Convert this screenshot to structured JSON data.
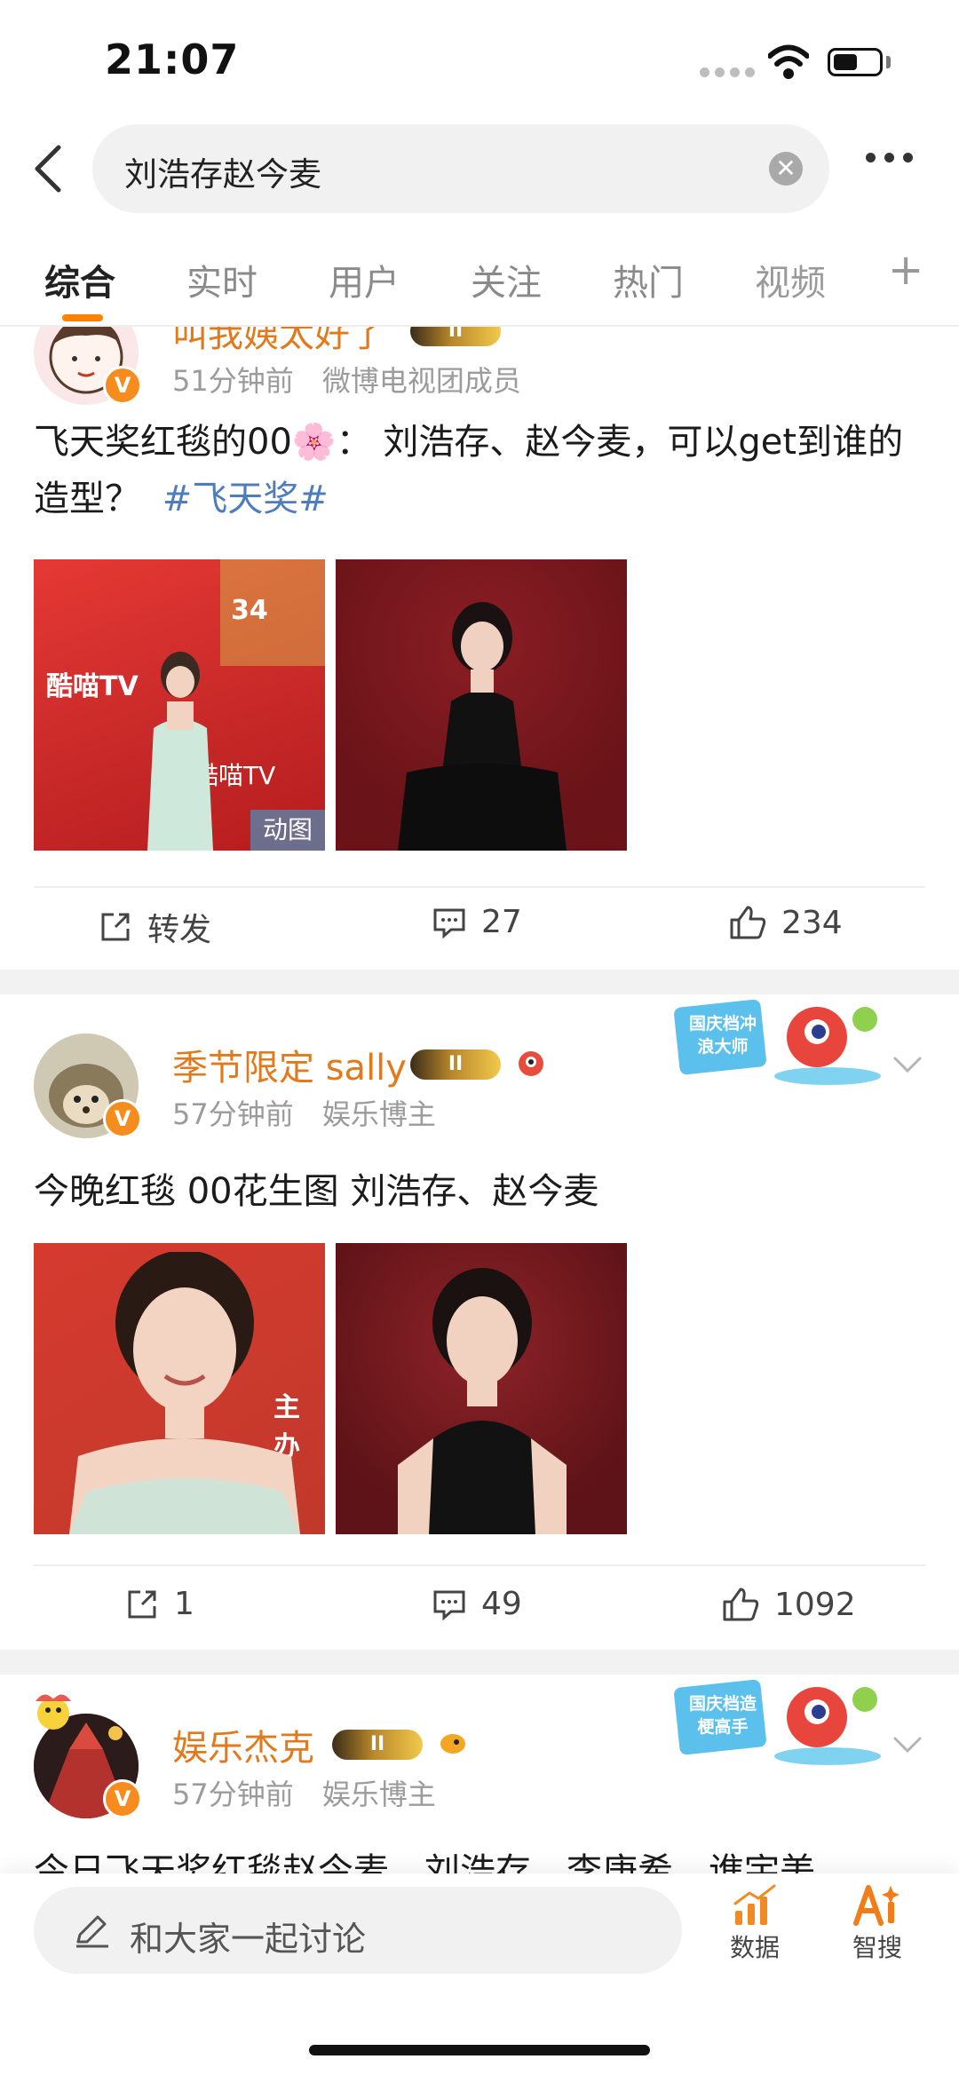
{
  "status_bar": {
    "time": "21:07"
  },
  "search": {
    "query": "刘浩存赵今麦"
  },
  "tabs": [
    {
      "label": "综合",
      "active": true
    },
    {
      "label": "实时",
      "active": false
    },
    {
      "label": "用户",
      "active": false
    },
    {
      "label": "关注",
      "active": false
    },
    {
      "label": "热门",
      "active": false
    },
    {
      "label": "视频",
      "active": false
    }
  ],
  "posts": [
    {
      "username_partial": "叫我姨太好了",
      "time": "51分钟前",
      "source": "微博电视团成员",
      "text": "飞天奖红毯的00🌸： 刘浩存、赵今麦，可以get到谁的造型？",
      "hashtag": "#飞天奖#",
      "images": [
        {
          "caption_number": "34",
          "brand": "酷喵TV",
          "brand2": "酷喵TV",
          "tag": "动图"
        },
        {
          "tag": ""
        }
      ],
      "actions": {
        "repost": "转发",
        "comments": "27",
        "likes": "234"
      }
    },
    {
      "username": "季节限定 sally",
      "vip_level": "II",
      "time": "57分钟前",
      "source": "娱乐博主",
      "badge_text": "国庆档冲浪大师",
      "text": "今晚红毯 00花生图 刘浩存、赵今麦",
      "images": [
        {
          "side_text": "主办"
        },
        {}
      ],
      "actions": {
        "repost": "1",
        "comments": "49",
        "likes": "1092"
      }
    },
    {
      "username": "娱乐杰克",
      "vip_level": "II",
      "time": "57分钟前",
      "source": "娱乐博主",
      "badge_text": "国庆档造梗高手",
      "text_partial": "今日飞天奖红毯赵今麦、刘浩存、李庚希、谯宇美"
    }
  ],
  "bottom_bar": {
    "comment_placeholder": "和大家一起讨论",
    "data_label": "数据",
    "smart_label": "智搜"
  },
  "colors": {
    "accent": "#ff8200",
    "username": "#e07a1c",
    "hashtag": "#4f7cba",
    "meta": "#9b9b9b"
  }
}
